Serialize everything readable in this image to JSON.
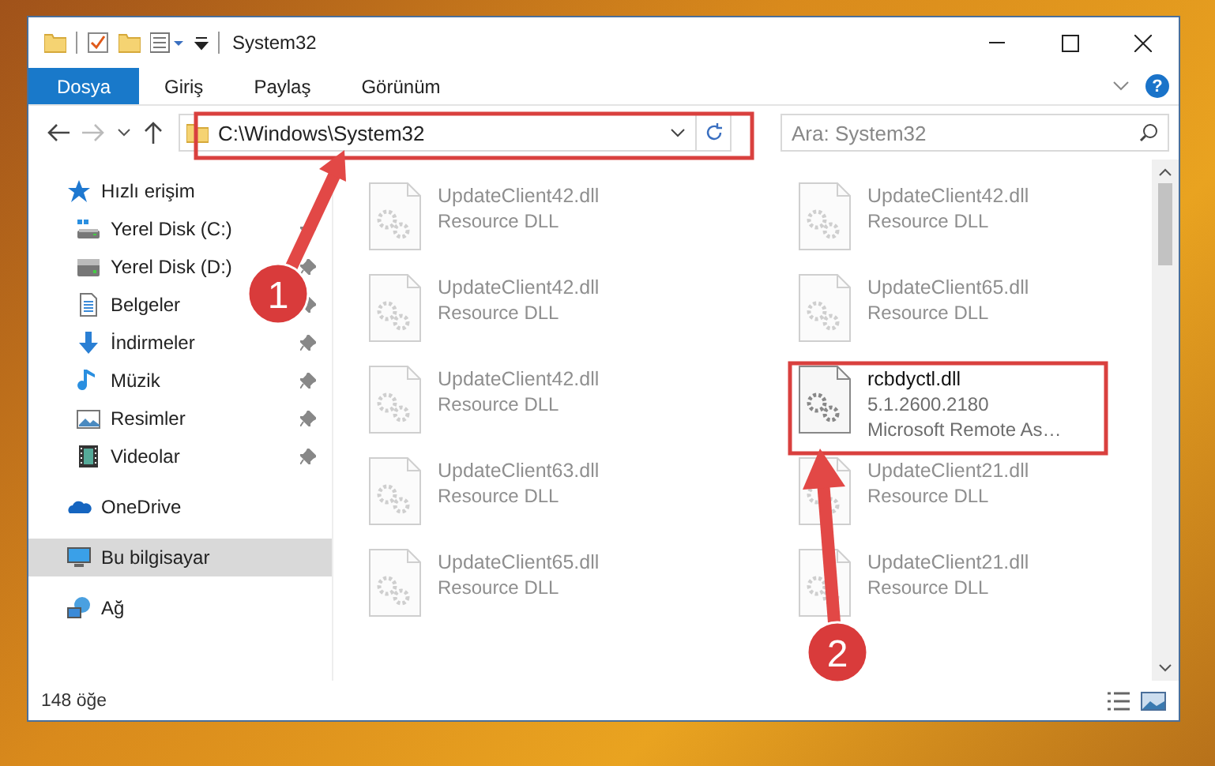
{
  "window": {
    "title": "System32"
  },
  "ribbon": {
    "tabs": [
      {
        "label": "Dosya",
        "selected": true
      },
      {
        "label": "Giriş",
        "selected": false
      },
      {
        "label": "Paylaş",
        "selected": false
      },
      {
        "label": "Görünüm",
        "selected": false
      }
    ],
    "help": "?"
  },
  "address": {
    "path": "C:\\Windows\\System32"
  },
  "search": {
    "placeholder": "Ara: System32"
  },
  "sidebar": {
    "items": [
      {
        "label": "Hızlı erişim",
        "kind": "star",
        "selected": false,
        "children": [
          {
            "label": "Yerel Disk (C:)",
            "kind": "system-drive",
            "pinned": true,
            "selected": false
          },
          {
            "label": "Yerel Disk (D:)",
            "kind": "drive",
            "pinned": true,
            "selected": false
          },
          {
            "label": "Belgeler",
            "kind": "document",
            "pinned": true,
            "selected": false
          },
          {
            "label": "İndirmeler",
            "kind": "download",
            "pinned": true,
            "selected": false
          },
          {
            "label": "Müzik",
            "kind": "music",
            "pinned": true,
            "selected": false
          },
          {
            "label": "Resimler",
            "kind": "picture",
            "pinned": true,
            "selected": false
          },
          {
            "label": "Videolar",
            "kind": "video",
            "pinned": true,
            "selected": false
          }
        ]
      },
      {
        "label": "OneDrive",
        "kind": "cloud",
        "selected": false
      },
      {
        "label": "Bu bilgisayar",
        "kind": "computer",
        "selected": true
      },
      {
        "label": "Ağ",
        "kind": "network",
        "selected": false
      }
    ]
  },
  "files": [
    {
      "name": "UpdateClient42.dll",
      "lines": [
        "Resource DLL"
      ],
      "faded": true
    },
    {
      "name": "UpdateClient42.dll",
      "lines": [
        "Resource DLL"
      ],
      "faded": true
    },
    {
      "name": "UpdateClient42.dll",
      "lines": [
        "Resource DLL"
      ],
      "faded": true
    },
    {
      "name": "UpdateClient65.dll",
      "lines": [
        "Resource DLL"
      ],
      "faded": true
    },
    {
      "name": "UpdateClient42.dll",
      "lines": [
        "Resource DLL"
      ],
      "faded": true
    },
    {
      "name": "rcbdyctl.dll",
      "lines": [
        "5.1.2600.2180",
        "Microsoft Remote As…"
      ],
      "faded": false
    },
    {
      "name": "UpdateClient63.dll",
      "lines": [
        "Resource DLL"
      ],
      "faded": true
    },
    {
      "name": "UpdateClient21.dll",
      "lines": [
        "Resource DLL"
      ],
      "faded": true
    },
    {
      "name": "UpdateClient65.dll",
      "lines": [
        "Resource DLL"
      ],
      "faded": true
    },
    {
      "name": "UpdateClient21.dll",
      "lines": [
        "Resource DLL"
      ],
      "faded": true
    }
  ],
  "status_bar": {
    "count": "148 öğe"
  },
  "callouts": [
    {
      "number": "1"
    },
    {
      "number": "2"
    }
  ]
}
